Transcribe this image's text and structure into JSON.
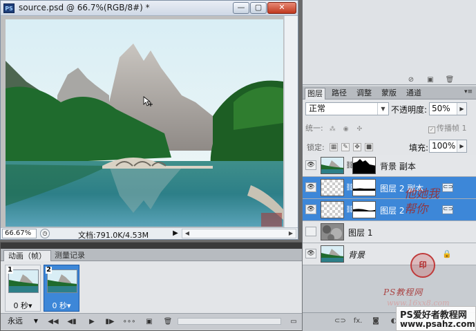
{
  "document": {
    "title": "source.psd @ 66.7%(RGB/8#) *",
    "app_icon": "PS",
    "window_controls": {
      "minimize": "—",
      "maximize": "▢",
      "close": "✕"
    },
    "zoom": "66.67%",
    "doc_size": "文档:791.0K/4.53M"
  },
  "animation_panel": {
    "tabs": [
      "动画（帧）",
      "测量记录"
    ],
    "active_tab": 0,
    "frames": [
      {
        "number": "1",
        "delay": "0 秒▾",
        "selected": false
      },
      {
        "number": "2",
        "delay": "0 秒▾",
        "selected": true
      }
    ],
    "loop": "永远",
    "controls": [
      "first-frame",
      "previous-frame",
      "play",
      "next-frame",
      "tween",
      "duplicate-frame",
      "delete-frame"
    ]
  },
  "layers_panel": {
    "tabs": [
      "图层",
      "路径",
      "调整",
      "蒙版",
      "通道"
    ],
    "active_tab": 0,
    "blend_mode": "正常",
    "opacity_label": "不透明度:",
    "opacity": "50%",
    "unify_label": "统一:",
    "propagate_label": "传播帧 1",
    "lock_label": "锁定:",
    "fill_label": "填充:",
    "fill": "100%",
    "layers": [
      {
        "name": "背景 副本",
        "visible": true,
        "selected": false,
        "has_mask": true,
        "linked": false,
        "locked": false,
        "italic": false,
        "thumb": "photo"
      },
      {
        "name": "图层 2 副本",
        "visible": true,
        "selected": true,
        "has_mask": true,
        "linked": true,
        "locked": false,
        "italic": false,
        "thumb": "transparent"
      },
      {
        "name": "图层 2",
        "visible": true,
        "selected": true,
        "has_mask": true,
        "linked": true,
        "locked": false,
        "italic": false,
        "thumb": "transparent"
      },
      {
        "name": "图层 1",
        "visible": false,
        "selected": false,
        "has_mask": false,
        "linked": false,
        "locked": false,
        "italic": false,
        "thumb": "clouds"
      },
      {
        "name": "背景",
        "visible": true,
        "selected": false,
        "has_mask": false,
        "linked": false,
        "locked": true,
        "italic": true,
        "thumb": "photo"
      }
    ]
  },
  "watermark": {
    "signature": "他她我帮你",
    "seal": "印",
    "site_line": "PS教程网",
    "site_line2": "www.16xx8.com",
    "badge_title": "PS爱好者教程网",
    "badge_url": "www.psahz.com"
  },
  "colors": {
    "selection_blue": "#3d87d8",
    "panel_gray": "#d6d9dd"
  }
}
